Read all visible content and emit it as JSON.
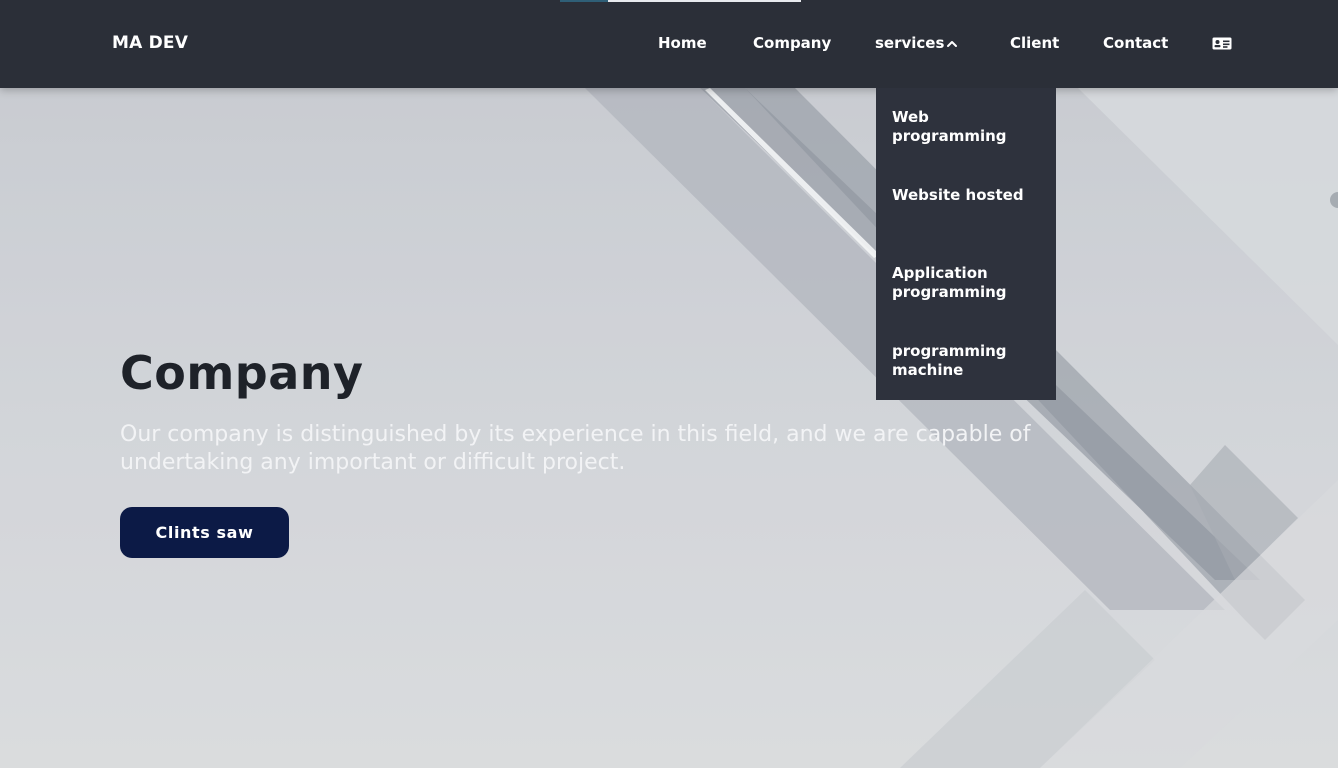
{
  "header": {
    "brand": "MA DEV",
    "nav": {
      "home": "Home",
      "company": "Company",
      "services": "services",
      "client": "Client",
      "contact": "Contact"
    },
    "services_expanded": true,
    "services_toggle_icon": "chevron-up-icon",
    "extra_icon": "contact-card-icon"
  },
  "services_menu": {
    "items": [
      "Web programming",
      "Website hosted",
      "Application programming",
      "programming machine"
    ]
  },
  "hero": {
    "title": "Company",
    "text": "Our company is distinguished by its experience in this field, and we are capable of undertaking any important or difficult project.",
    "button_label": "Clints saw"
  },
  "colors": {
    "header_bg": "#2b2f38",
    "dropdown_bg": "#2e323d",
    "button_bg": "#0c1a46",
    "title_color": "#1e2229",
    "accent": "#2f5f77"
  }
}
